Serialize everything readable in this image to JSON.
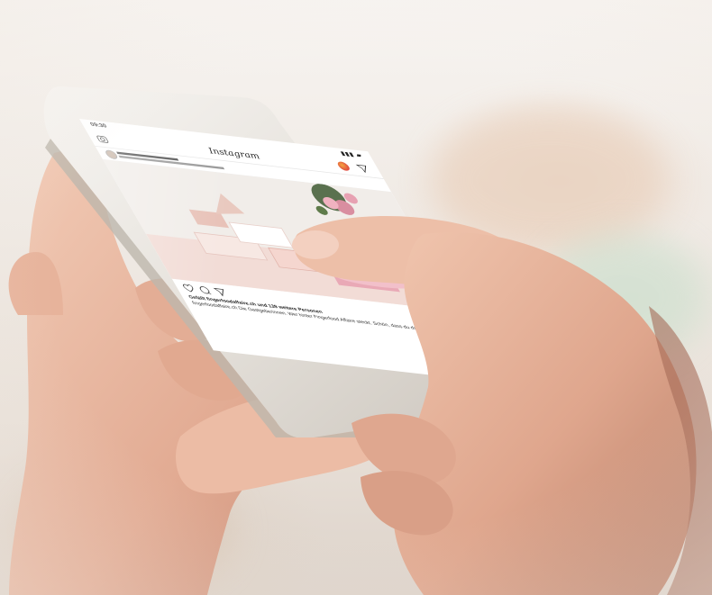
{
  "status_bar": {
    "time": "09:30",
    "icons": "▮▮▮ ▰"
  },
  "app": {
    "logo": "Instagram"
  },
  "post": {
    "likes_line": "Gefällt fingerfoodaffaire.ch und 139 weitere Personen",
    "caption": "fingerfoodaffaire.ch Die Gastgeberinnen. Wer hinter Fingerfood Affaire steckt. Schön, dass du da bist... mehr"
  },
  "icons": {
    "camera": "camera-icon",
    "story": "story-avatar-icon",
    "send": "direct-message-icon",
    "like": "heart-icon",
    "comment": "comment-icon",
    "share": "share-icon",
    "save": "bookmark-icon"
  },
  "colors": {
    "story_ring": "#e04a3f",
    "skin": "#e8b9a2",
    "phone_frame": "#ece9e4"
  }
}
